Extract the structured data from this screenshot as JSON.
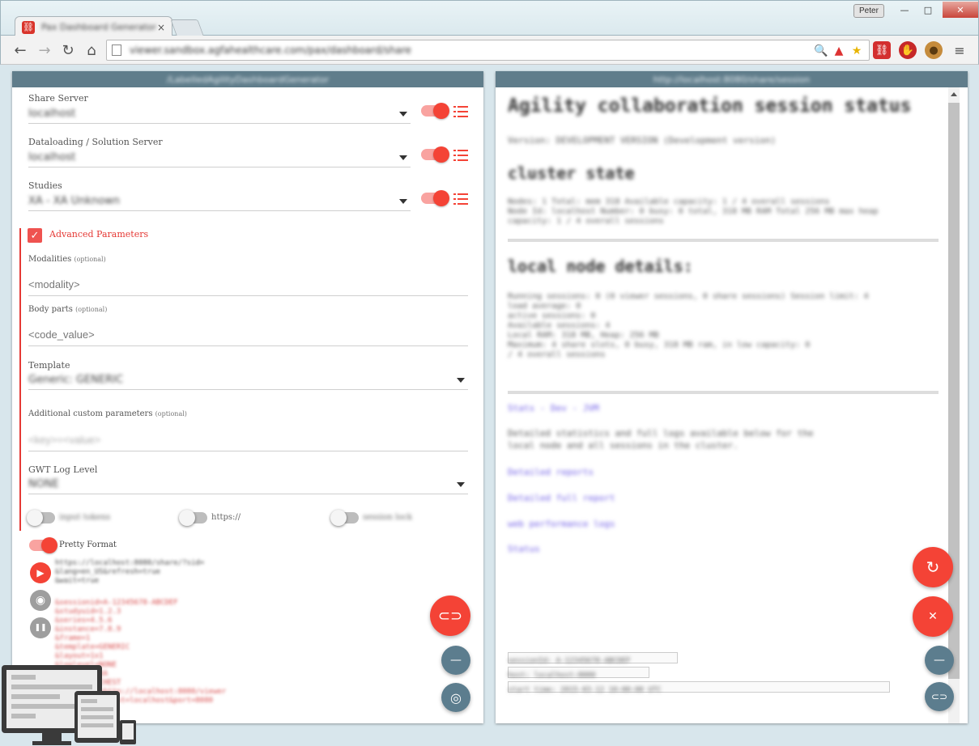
{
  "browser": {
    "tab_title": "Pax Dashboard Generator",
    "tab_close": "×",
    "user": "Peter",
    "url": "viewer.sandbox.agfahealthcare.com/pax/dashboard/share",
    "win_min": "—",
    "win_max": "□",
    "win_close": "✕"
  },
  "left_panel": {
    "header": "/LabelledAgilityDashboardGenerator",
    "share_server": {
      "label": "Share Server",
      "value": "localhost"
    },
    "dataloading_server": {
      "label": "Dataloading / Solution Server",
      "value": "localhost"
    },
    "studies": {
      "label": "Studies",
      "value": "XA - XA Unknown"
    },
    "advanced": {
      "label": "Advanced Parameters"
    },
    "modalities": {
      "label": "Modalities",
      "optional": "(optional)",
      "placeholder": "<modality>"
    },
    "body_parts": {
      "label": "Body parts",
      "optional": "(optional)",
      "placeholder": "<code_value>"
    },
    "template": {
      "label": "Template",
      "value": "Generic: GENERIC"
    },
    "custom_params": {
      "label": "Additional custom parameters",
      "optional": "(optional)",
      "placeholder": "<key>=<value>"
    },
    "log_level": {
      "label": "GWT Log Level",
      "value": "NONE"
    },
    "toggles": [
      {
        "label": "input tokens",
        "on": false
      },
      {
        "label": "https://",
        "on": false
      },
      {
        "label": "session lock",
        "on": false
      }
    ],
    "pretty_format": {
      "label": "Pretty Format",
      "on": true
    },
    "code_block_1": "https://localhost:8080/share/?sid=\n&lang=en_US&refresh=true\n&wait=true",
    "code_block_2": "&sessionid=A-12345678-ABCDEF\n&studyuid=1.2.3\n&series=4.5.6\n&instance=7.8.9\n&frame=1\n&template=GENERIC\n&layout=1x1\n&loglevel=NONE\n&modality=XA\n&bodypart=CHEST\n&viewerurl=http://localhost:8080/viewer\n&user=admin&host=localhost&port=8080"
  },
  "right_panel": {
    "header": "http://localhost:8080/share/session",
    "title": "Agility collaboration session status",
    "version": "Version: DEVELOPMENT VERSION (Development version)",
    "cluster_heading": "cluster state",
    "cluster_text": "Nodes: 1 Total: mem 318 Available capacity: 1 / 4 overall sessions\nNode Id: localhost Number: 0 busy: 0 total, 318 MB RAM Total 256 MB max heap\ncapacity: 1 / 4 overall sessions",
    "local_heading": "local node details:",
    "local_text": "Running sessions: 0 (0 viewer sessions, 0 share sessions) Session limit: 4\nload average: 0\nactive sessions: 0\nAvailable sessions: 4\nLocal RAM: 318 MB, Heap: 256 MB\nMaximum: 4 share slots, 0 busy, 318 MB ram, in low capacity: 0\n/ 4 overall sessions",
    "links": [
      "Stats - Dev - JVM",
      "Detailed reports",
      "Detailed full report",
      "web performance logs",
      "Status"
    ],
    "links_desc": "Detailed statistics and full logs available below for the\nlocal node and all sessions in the cluster.",
    "footer_lines": [
      "sessionId: A-12345678-ABCDEF",
      "host: localhost:8080",
      "start time: 2015-03-12 10:00:00 UTC"
    ]
  },
  "colors": {
    "accent": "#f44336",
    "header": "#607d8b",
    "fab_secondary": "#5c7d8e"
  },
  "icons": {
    "play": "▶",
    "eye": "◉",
    "pause": "❚❚",
    "link": "🔗",
    "refresh": "↻",
    "cancel": "✕",
    "remove": "—",
    "camera": "◎"
  }
}
